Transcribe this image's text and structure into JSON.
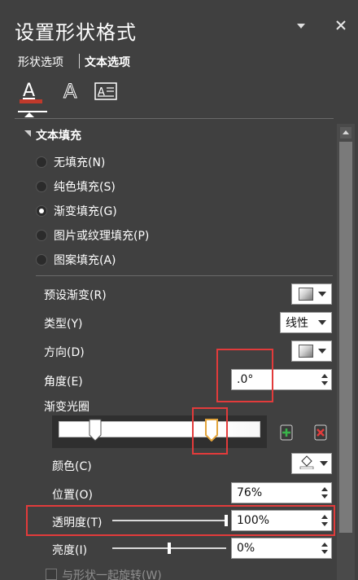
{
  "pane": {
    "title": "设置形状格式"
  },
  "tabs": [
    {
      "label": "形状选项",
      "active": false
    },
    {
      "label": "文本选项",
      "active": true
    }
  ],
  "icon_tabs": [
    "text-fill-outline-icon",
    "text-effects-icon",
    "textbox-icon"
  ],
  "section": {
    "title": "文本填充"
  },
  "fill_options": [
    {
      "label": "无填充(N)",
      "checked": false
    },
    {
      "label": "纯色填充(S)",
      "checked": false
    },
    {
      "label": "渐变填充(G)",
      "checked": true
    },
    {
      "label": "图片或纹理填充(P)",
      "checked": false
    },
    {
      "label": "图案填充(A)",
      "checked": false
    }
  ],
  "props": {
    "preset_gradient": "预设渐变(R)",
    "type_label": "类型(Y)",
    "type_value": "线性",
    "direction": "方向(D)",
    "angle_label": "角度(E)",
    "angle_value": ".0°",
    "stops_label": "渐变光圈",
    "color_label": "颜色(C)",
    "position_label": "位置(O)",
    "position_value": "76%",
    "transparency_label": "透明度(T)",
    "transparency_value": "100%",
    "brightness_label": "亮度(I)",
    "brightness_value": "0%",
    "rotate_label": "与形状一起旋转(W)"
  },
  "slider_levels": {
    "transparency_fraction": 1.0,
    "brightness_fraction": 0.5
  },
  "gradient_stops": [
    {
      "position_fraction": 0.18,
      "selected": false
    },
    {
      "position_fraction": 0.76,
      "selected": true
    }
  ],
  "colors": {
    "pane_bg": "#404040",
    "highlight_red": "#e23b3b",
    "selected_stop": "#e3a43b",
    "text_fill_underline": "#c0392b"
  }
}
